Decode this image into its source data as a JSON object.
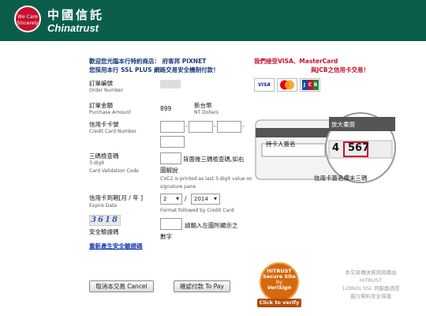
{
  "header": {
    "logo_text": "We Care Sincerely",
    "brand_cn": "中國信託",
    "brand_en": "Chinatrust"
  },
  "welcome": {
    "line1_prefix": "歡迎您光臨本行特約商店： 府客邦 PIXNET",
    "line2": "您採用本行 SSL PLUS 網路交易安全機制付款！"
  },
  "accept": {
    "line1": "接受VISA、MasterCard",
    "line1_prefix": "我們",
    "line2": "與JCB之信用卡交易！",
    "cards": [
      "VISA",
      "MC",
      "JCB"
    ]
  },
  "form": {
    "order": {
      "label": "訂單編號",
      "sub": "Order Number",
      "value": ""
    },
    "amount": {
      "label": "訂單金額",
      "sub": "Purchase Amount",
      "value": "899",
      "currency": "新台幣",
      "currency_en": "NT Dollars"
    },
    "card_number": {
      "label": "信用卡卡號",
      "sub": "Credit Card Number"
    },
    "cvv": {
      "label": "三碼檢查碼",
      "sub1": "3-digit",
      "sub2": "Card Validation Code",
      "note1": "背面後三碼檢查碼,如右",
      "note2": "圖解說",
      "note_en1": "CVC2 is printed as last 3-digit value on",
      "note_en2": "signature pane"
    },
    "expiry": {
      "label": "信用卡到期[月 / 年 ]",
      "sub": "Expire Date",
      "month": "2",
      "separator": "/",
      "year": "2014",
      "note": "Format followed by Credit Card"
    },
    "captcha": {
      "image_text": "3618",
      "label": "安全驗證碼",
      "hint1": "請輸入左圖所顯示之",
      "hint2": "數字",
      "regen_link": "重新產生安全驗證碼"
    }
  },
  "card_illustration": {
    "magnify_label": "放大畫面",
    "holder_label": "持卡人簽名",
    "digit_prefix": "4",
    "cvc": "567",
    "caption": "信用卡簽名欄末三碼"
  },
  "buttons": {
    "cancel": "取消本交易 Cancel",
    "confirm": "確認付款 To Pay"
  },
  "badge": {
    "line1": "HiTRUST",
    "line2": "Secure Site",
    "line3": "by",
    "line4": "VeriSign",
    "verify": "Click to verify"
  },
  "security_note": {
    "line1": "本交易傳送資訊將藉由",
    "line2": "HiTRUST",
    "line3": "128bits SSL 伺服器憑證",
    "line4": "進行資料安全保護"
  },
  "colors": {
    "header": "#0c5e4c",
    "accent_red": "#c8102e",
    "welcome_blue": "#1a3b7a"
  }
}
